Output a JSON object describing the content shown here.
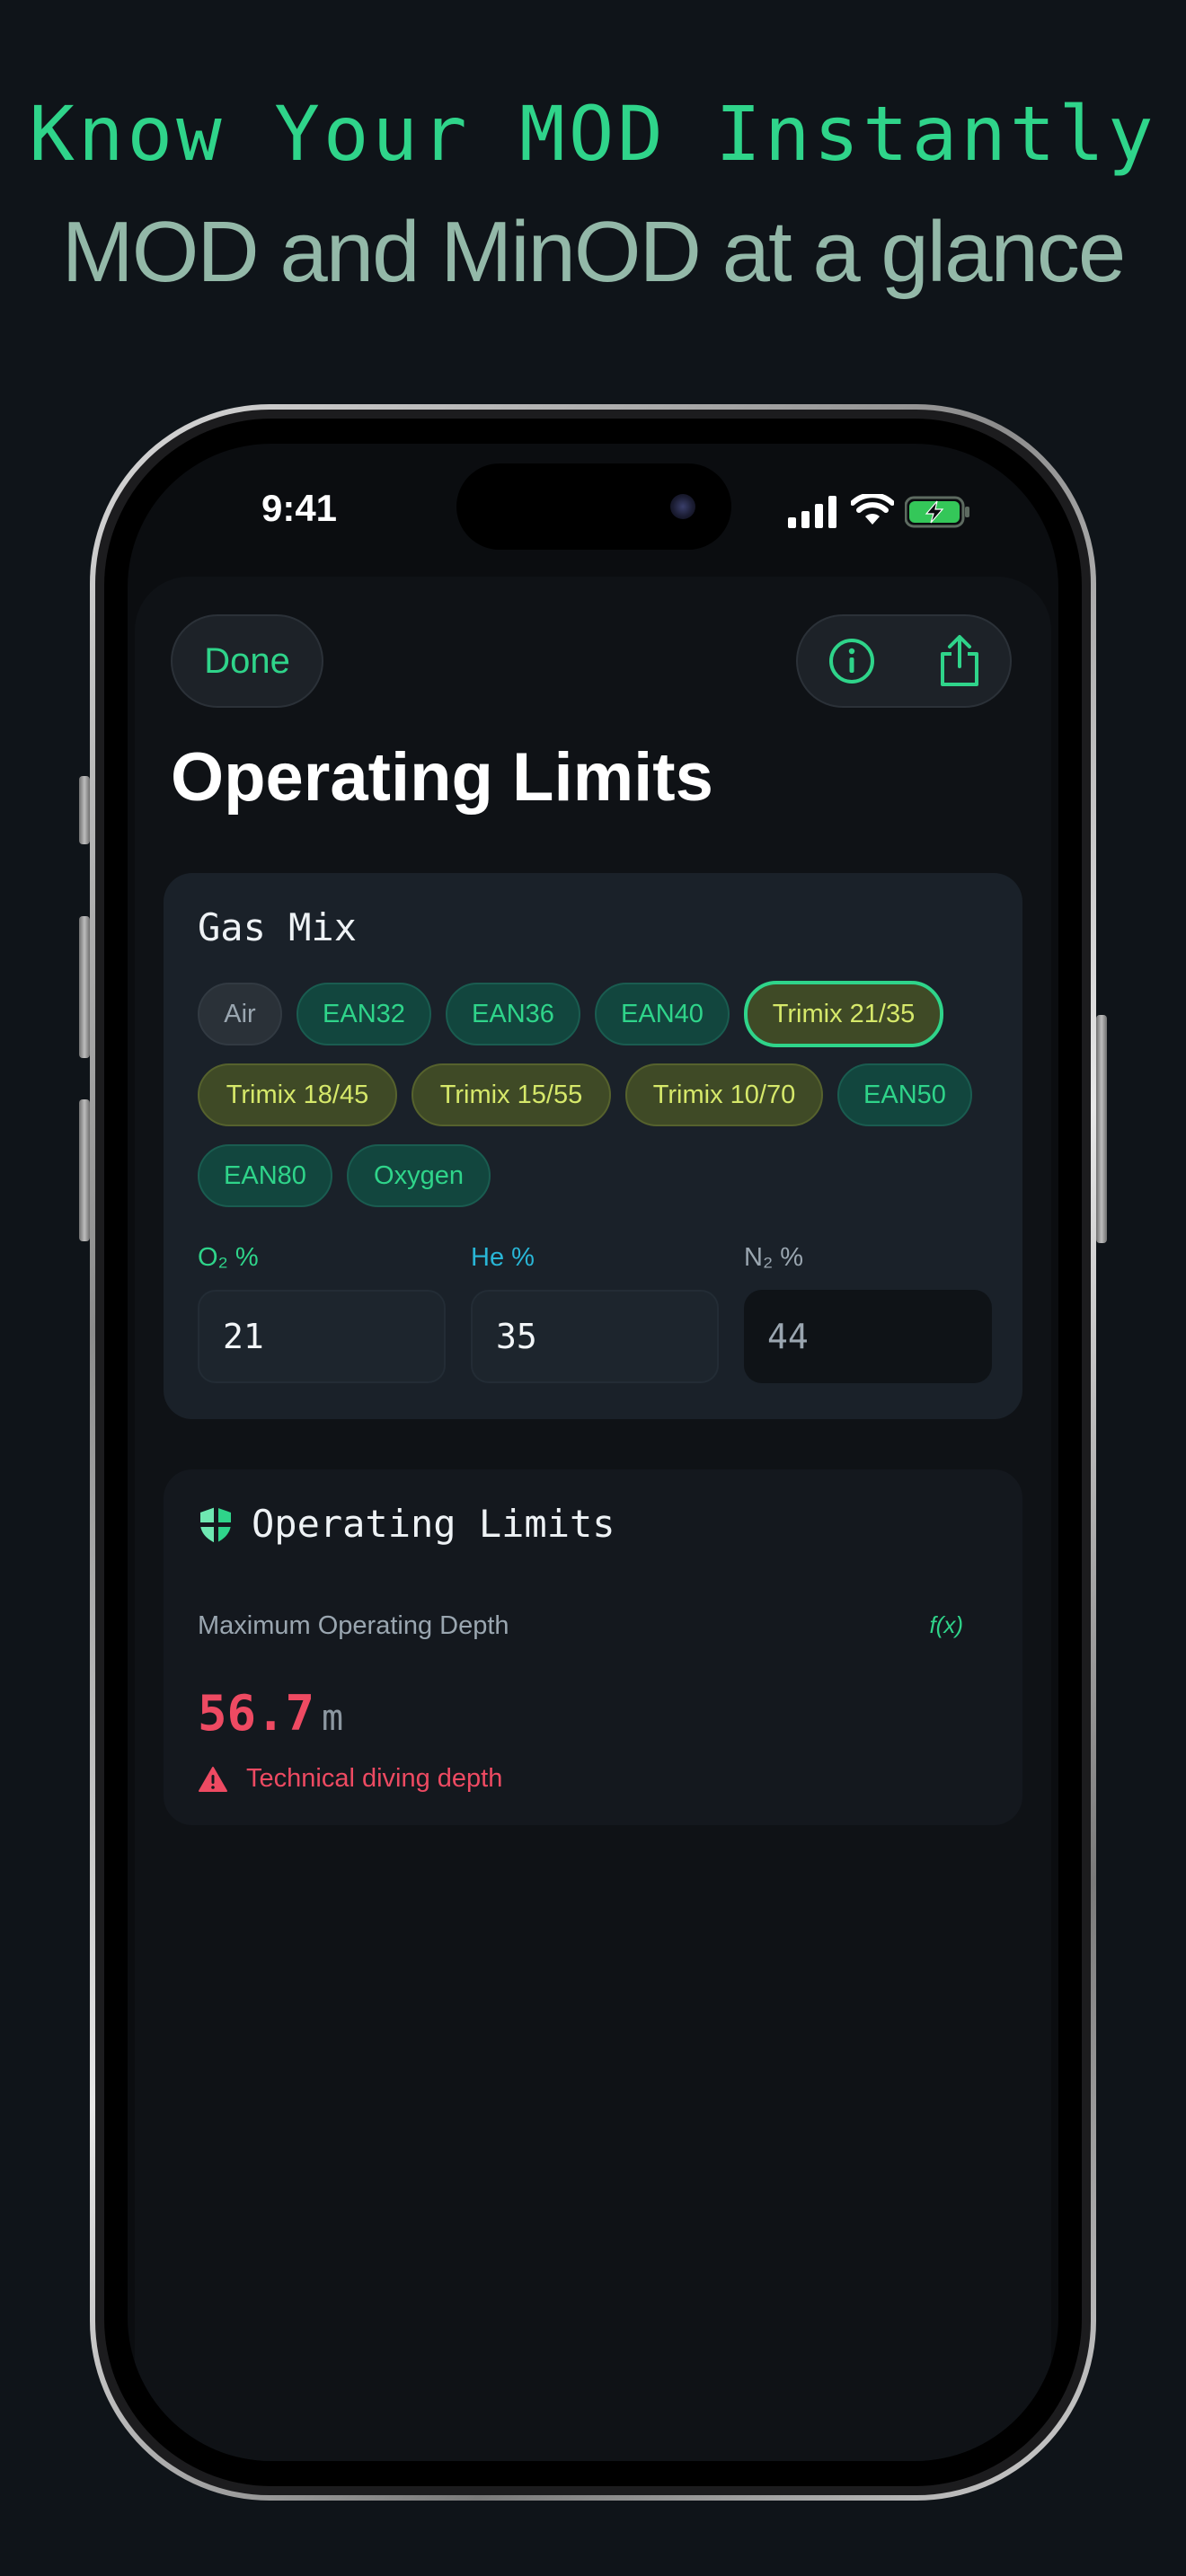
{
  "marketing": {
    "headline": "Know Your MOD Instantly",
    "subheadline": "MOD and MinOD at a glance"
  },
  "status_bar": {
    "time": "9:41",
    "icons": [
      "cellular-signal-icon",
      "wifi-icon",
      "battery-charging-icon"
    ]
  },
  "nav": {
    "done_label": "Done",
    "info_icon": "info-circle-icon",
    "share_icon": "share-icon"
  },
  "page": {
    "title": "Operating Limits"
  },
  "gas_mix": {
    "title": "Gas Mix",
    "presets": [
      {
        "label": "Air",
        "kind": "air",
        "selected": false
      },
      {
        "label": "EAN32",
        "kind": "nitrox",
        "selected": false
      },
      {
        "label": "EAN36",
        "kind": "nitrox",
        "selected": false
      },
      {
        "label": "EAN40",
        "kind": "nitrox",
        "selected": false
      },
      {
        "label": "Trimix 21/35",
        "kind": "trimix",
        "selected": true
      },
      {
        "label": "Trimix 18/45",
        "kind": "trimix",
        "selected": false
      },
      {
        "label": "Trimix 15/55",
        "kind": "trimix",
        "selected": false
      },
      {
        "label": "Trimix 10/70",
        "kind": "trimix",
        "selected": false
      },
      {
        "label": "EAN50",
        "kind": "nitrox",
        "selected": false
      },
      {
        "label": "EAN80",
        "kind": "nitrox",
        "selected": false
      },
      {
        "label": "Oxygen",
        "kind": "nitrox",
        "selected": false
      }
    ],
    "fields": {
      "o2": {
        "label": "O₂ %",
        "value": "21",
        "label_color": "#2fd48a"
      },
      "he": {
        "label": "He %",
        "value": "35",
        "label_color": "#29b6d6"
      },
      "n2": {
        "label": "N₂ %",
        "value": "44",
        "label_color": "#9aa6b0",
        "readonly": true
      }
    }
  },
  "limits": {
    "title": "Operating Limits",
    "title_icon": "shield-icon",
    "mod_label": "Maximum Operating Depth",
    "formula_icon_label": "f(x)",
    "mod_value": "56.7",
    "mod_unit": "m",
    "warning_text": "Technical diving depth",
    "warning_icon": "warning-triangle-icon"
  },
  "colors": {
    "accent": "#2fd48a",
    "danger": "#ee4a62",
    "trimix": "#d6e86a",
    "helium": "#29b6d6"
  }
}
